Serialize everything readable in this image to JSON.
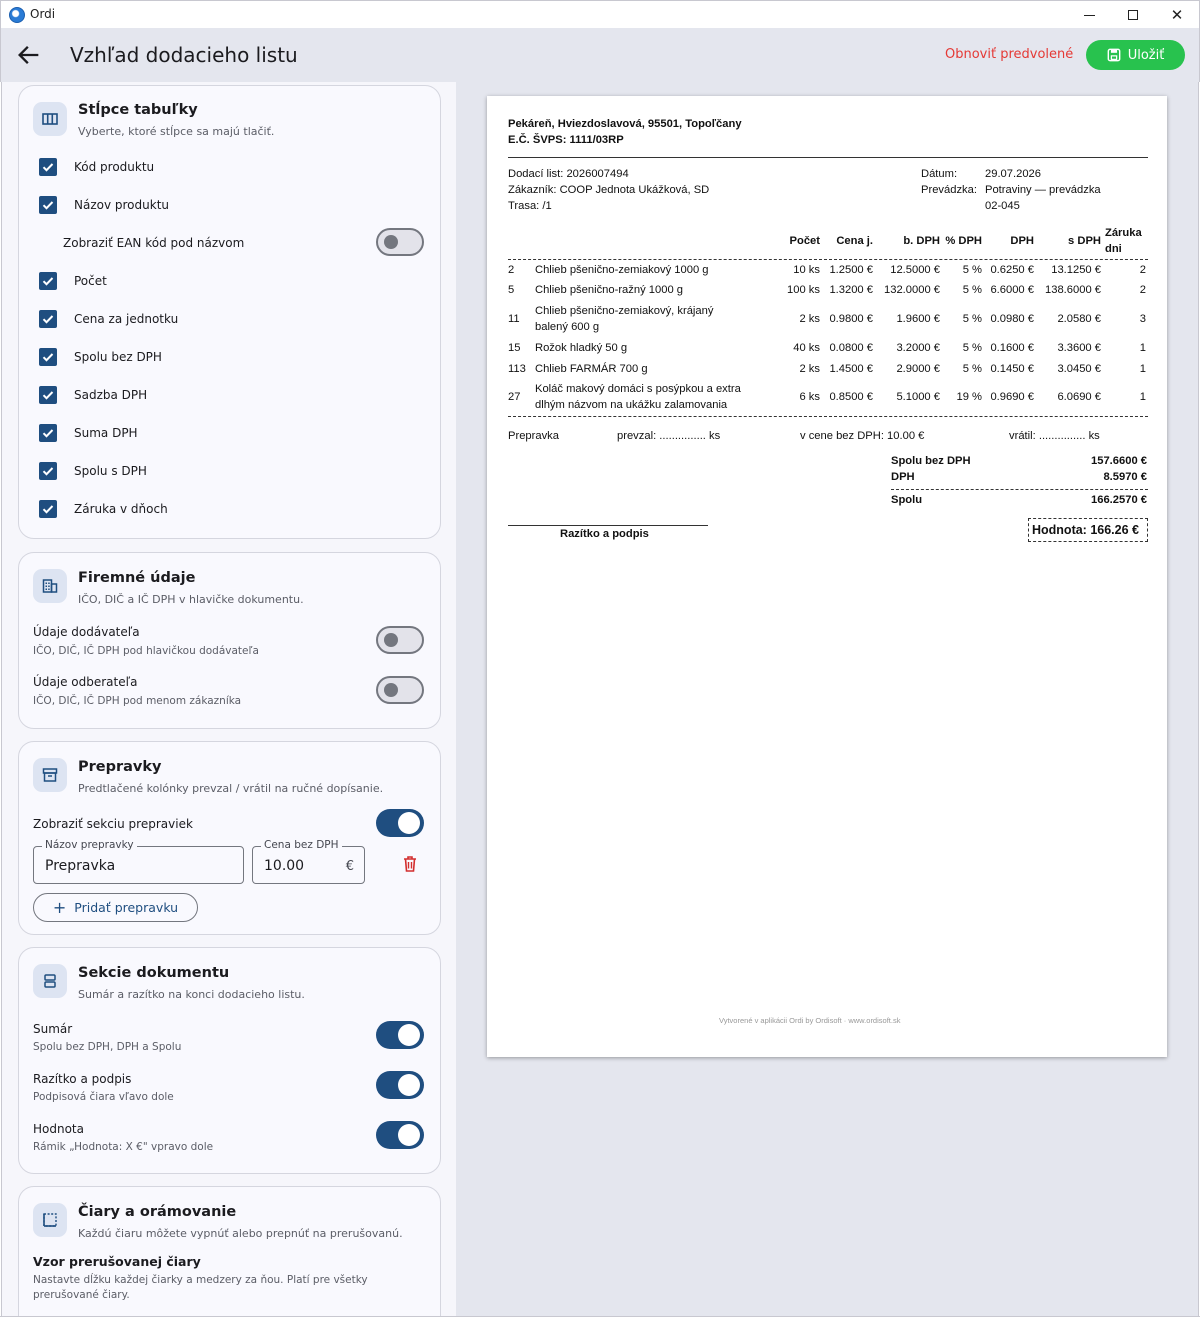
{
  "window": {
    "app_name": "Ordi"
  },
  "appbar": {
    "title": "Vzhľad dodacieho listu",
    "reset_label": "Obnoviť predvolené",
    "save_label": "Uložiť"
  },
  "columns_card": {
    "title": "Stĺpce tabuľky",
    "subtitle": "Vyberte, ktoré stĺpce sa majú tlačiť.",
    "items": [
      "Kód produktu",
      "Názov produktu",
      "Zobraziť EAN kód pod názvom",
      "Počet",
      "Cena za jednotku",
      "Spolu bez DPH",
      "Sadzba DPH",
      "Suma DPH",
      "Spolu s DPH",
      "Záruka v dňoch"
    ]
  },
  "company_card": {
    "title": "Firemné údaje",
    "subtitle": "IČO, DIČ a IČ DPH v hlavičke dokumentu.",
    "supplier_label": "Údaje dodávateľa",
    "supplier_sub": "IČO, DIČ, IČ DPH pod hlavičkou dodávateľa",
    "customer_label": "Údaje odberateľa",
    "customer_sub": "IČO, DIČ, IČ DPH pod menom zákazníka"
  },
  "crates_card": {
    "title": "Prepravky",
    "subtitle": "Predtlačené kolónky prevzal / vrátil na ručné dopísanie.",
    "show_label": "Zobraziť sekciu prepraviek",
    "name_legend": "Názov prepravky",
    "name_value": "Prepravka",
    "price_legend": "Cena bez DPH",
    "price_value": "10.00",
    "price_suffix": "€",
    "add_label": "Pridať prepravku"
  },
  "sections_card": {
    "title": "Sekcie dokumentu",
    "subtitle": "Sumár a razítko na konci dodacieho listu.",
    "summary_label": "Sumár",
    "summary_sub": "Spolu bez DPH, DPH a Spolu",
    "stamp_label": "Razítko a podpis",
    "stamp_sub": "Podpisová čiara vľavo dole",
    "value_label": "Hodnota",
    "value_sub": "Rámik „Hodnota: X €\" vpravo dole"
  },
  "lines_card": {
    "title": "Čiary a orámovanie",
    "subtitle": "Každú čiaru môžete vypnúť alebo prepnúť na prerušovanú.",
    "pattern_title": "Vzor prerušovanej čiary",
    "pattern_sub1": "Nastavte dĺžku každej čiarky a medzery za ňou. Platí pre všetky",
    "pattern_sub2": "prerušované čiary."
  },
  "doc": {
    "company": "Pekáreň, Hviezdoslavová, 95501, Topoľčany",
    "ec": "E.Č. ŠVPS: 1111/03RP",
    "delivery_note": "Dodací list: 2026007494",
    "customer": "Zákazník: COOP Jednota Ukážková, SD",
    "route": "Trasa: /1",
    "date_label": "Dátum:",
    "date_value": "29.07.2026",
    "store_label": "Prevádzka:",
    "store_value1": "Potraviny — prevádzka",
    "store_value2": "02-045",
    "headers": {
      "count": "Počet",
      "unit_price": "Cena j.",
      "net": "b. DPH",
      "vat_rate": "% DPH",
      "vat": "DPH",
      "gross": "s DPH",
      "warranty1": "Záruka",
      "warranty2": "dni"
    },
    "rows": [
      {
        "code": "2",
        "name1": "Chlieb pšenično-zemiakový 1000 g",
        "name2": "",
        "count": "10 ks",
        "unit": "1.2500 €",
        "net": "12.5000 €",
        "rate": "5 %",
        "vat": "0.6250 €",
        "gross": "13.1250 €",
        "warranty": "2"
      },
      {
        "code": "5",
        "name1": "Chlieb pšenično-ražný 1000 g",
        "name2": "",
        "count": "100 ks",
        "unit": "1.3200 €",
        "net": "132.0000 €",
        "rate": "5 %",
        "vat": "6.6000 €",
        "gross": "138.6000 €",
        "warranty": "2"
      },
      {
        "code": "11",
        "name1": "Chlieb pšenično-zemiakový, krájaný",
        "name2": "balený 600 g",
        "count": "2 ks",
        "unit": "0.9800 €",
        "net": "1.9600 €",
        "rate": "5 %",
        "vat": "0.0980 €",
        "gross": "2.0580 €",
        "warranty": "3"
      },
      {
        "code": "15",
        "name1": "Rožok hladký 50 g",
        "name2": "",
        "count": "40 ks",
        "unit": "0.0800 €",
        "net": "3.2000 €",
        "rate": "5 %",
        "vat": "0.1600 €",
        "gross": "3.3600 €",
        "warranty": "1"
      },
      {
        "code": "113",
        "name1": "Chlieb FARMÁR 700 g",
        "name2": "",
        "count": "2 ks",
        "unit": "1.4500 €",
        "net": "2.9000 €",
        "rate": "5 %",
        "vat": "0.1450 €",
        "gross": "3.0450 €",
        "warranty": "1"
      },
      {
        "code": "27",
        "name1": "Koláč makový domáci s posýpkou a extra",
        "name2": "dlhým názvom na ukážku zalamovania",
        "count": "6 ks",
        "unit": "0.8500 €",
        "net": "5.1000 €",
        "rate": "19 %",
        "vat": "0.9690 €",
        "gross": "6.0690 €",
        "warranty": "1"
      }
    ],
    "crate_name": "Prepravka",
    "crate_received": "prevzal: ............... ks",
    "crate_price": "v cene bez DPH: 10.00 €",
    "crate_returned": "vrátil: ............... ks",
    "sum_net_label": "Spolu bez DPH",
    "sum_net_value": "157.6600 €",
    "sum_vat_label": "DPH",
    "sum_vat_value": "8.5970 €",
    "sum_total_label": "Spolu",
    "sum_total_value": "166.2570 €",
    "stamp_label": "Razítko a podpis",
    "value_box": "Hodnota: 166.26 €",
    "footer": "Vytvorené v aplikácii Ordi by Ordisoft · www.ordisoft.sk"
  }
}
